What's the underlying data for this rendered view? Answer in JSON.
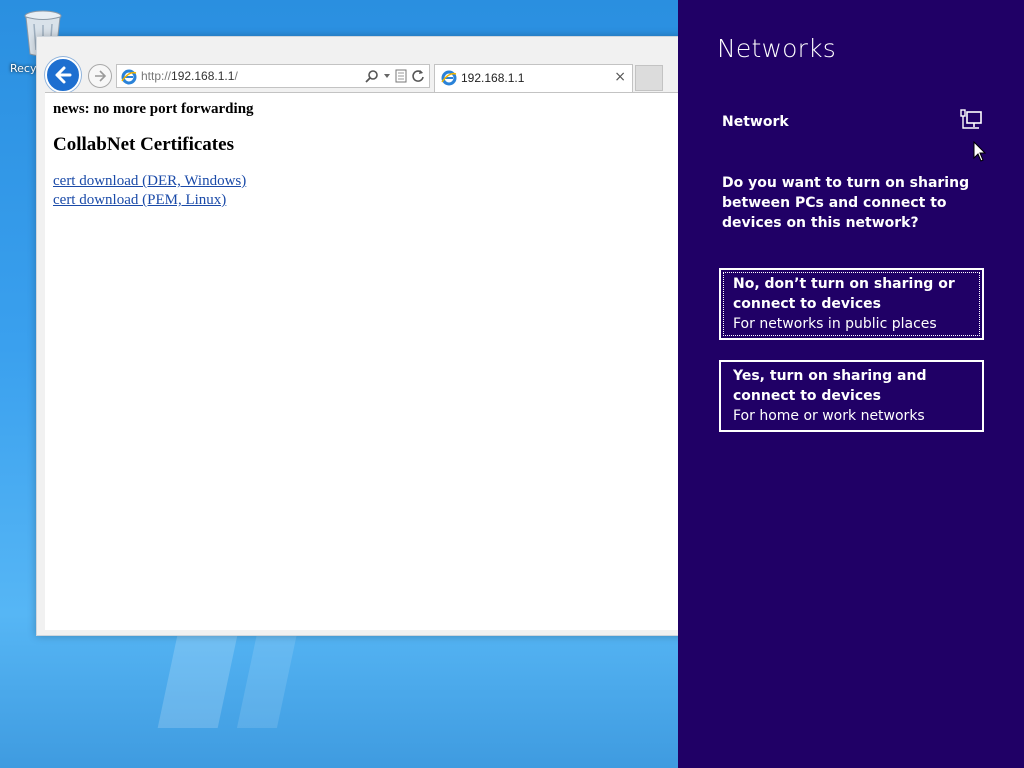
{
  "desktop": {
    "recycle_bin_label": "Recyc"
  },
  "browser": {
    "address": {
      "prefix": "http://",
      "host": "192.168.1.1",
      "suffix": "/"
    },
    "tab": {
      "title": "192.168.1.1",
      "close_glyph": "×"
    },
    "page": {
      "news": "news: no more port forwarding",
      "heading": "CollabNet Certificates",
      "links": [
        "cert download (DER, Windows)",
        "cert download (PEM, Linux)"
      ]
    }
  },
  "networks_pane": {
    "title": "Networks",
    "network_name": "Network",
    "network_icon": "network-wired-icon",
    "question": "Do you want to turn on sharing between PCs and connect to devices on this network?",
    "options": [
      {
        "title": "No, don’t turn on sharing or connect to devices",
        "subtitle": "For networks in public places",
        "selected": true
      },
      {
        "title": "Yes, turn on sharing and connect to devices",
        "subtitle": "For home or work networks",
        "selected": false
      }
    ]
  },
  "taskbar": {
    "items": [
      "internet-explorer-icon",
      "file-explorer-icon"
    ]
  },
  "colors": {
    "pane_background": "#200066",
    "back_button": "#1e6fd0",
    "link": "#1a4aa8"
  }
}
